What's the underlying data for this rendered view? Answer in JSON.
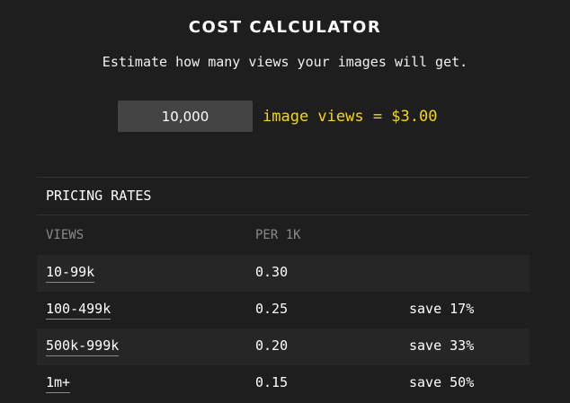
{
  "title": "COST CALCULATOR",
  "subtitle": "Estimate how many views your images will get.",
  "calculator": {
    "input_value": "10,000",
    "result_text": "image views = $3.00"
  },
  "pricing": {
    "header": "PRICING RATES",
    "columns": [
      "VIEWS",
      "PER 1K"
    ],
    "rows": [
      {
        "tier": "10-99k",
        "rate": "0.30",
        "savings": ""
      },
      {
        "tier": "100-499k",
        "rate": "0.25",
        "savings": "save 17%"
      },
      {
        "tier": "500k-999k",
        "rate": "0.20",
        "savings": "save 33%"
      },
      {
        "tier": "1m+",
        "rate": "0.15",
        "savings": "save 50%"
      }
    ]
  },
  "colors": {
    "background": "#1e1e1e",
    "accent_yellow": "#f5d90a",
    "input_bg": "#444444",
    "muted_text": "#8a8a8a"
  }
}
